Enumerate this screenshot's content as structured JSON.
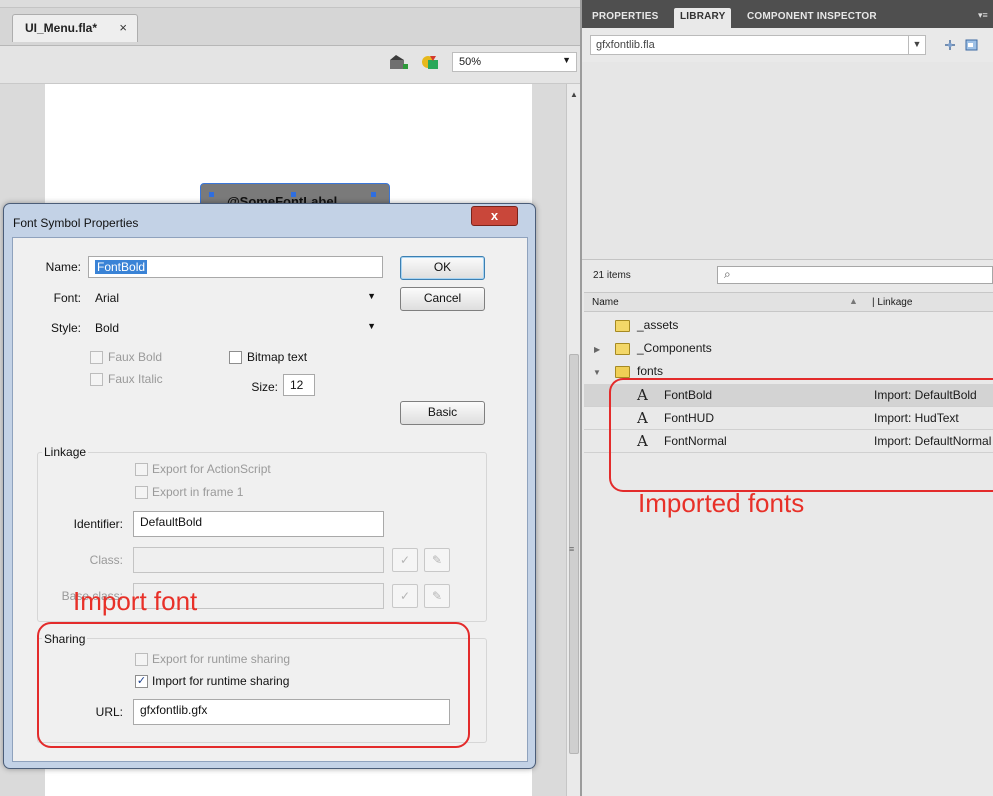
{
  "document": {
    "tab_title": "UI_Menu.fla*",
    "tab_close": "×",
    "zoom": "50%",
    "stage_object_label": "@SomeFontLabel"
  },
  "panel": {
    "tabs": [
      "PROPERTIES",
      "LIBRARY",
      "COMPONENT INSPECTOR"
    ],
    "active_tab": "LIBRARY",
    "library_file": "gfxfontlib.fla",
    "items_count": "21 items",
    "columns": {
      "name": "Name",
      "linkage": "Linkage"
    },
    "items": [
      {
        "name": "_assets",
        "kind": "folder"
      },
      {
        "name": "_Components",
        "kind": "folder"
      },
      {
        "name": "fonts",
        "kind": "folder-open"
      },
      {
        "name": "FontBold",
        "kind": "font",
        "linkage": "Import: DefaultBold"
      },
      {
        "name": "FontHUD",
        "kind": "font",
        "linkage": "Import: HudText"
      },
      {
        "name": "FontNormal",
        "kind": "font",
        "linkage": "Import: DefaultNormal"
      }
    ]
  },
  "dialog": {
    "title": "Font Symbol Properties",
    "close": "x",
    "name_label": "Name:",
    "name_value": "FontBold",
    "font_label": "Font:",
    "font_value": "Arial",
    "style_label": "Style:",
    "style_value": "Bold",
    "faux_bold": "Faux Bold",
    "faux_italic": "Faux Italic",
    "bitmap_text": "Bitmap text",
    "size_label": "Size:",
    "size_value": "12",
    "ok": "OK",
    "cancel": "Cancel",
    "basic": "Basic",
    "linkage_group": "Linkage",
    "export_actionscript": "Export for ActionScript",
    "export_frame1": "Export in frame 1",
    "identifier_label": "Identifier:",
    "identifier_value": "DefaultBold",
    "class_label": "Class:",
    "base_class_label": "Base class:",
    "sharing_group": "Sharing",
    "export_runtime": "Export for runtime sharing",
    "import_runtime": "Import for runtime sharing",
    "import_runtime_checked": true,
    "url_label": "URL:",
    "url_value": "gfxfontlib.gfx"
  },
  "annotations": {
    "import_font": "Import font",
    "imported_fonts": "Imported fonts",
    "color": "#e83028"
  }
}
